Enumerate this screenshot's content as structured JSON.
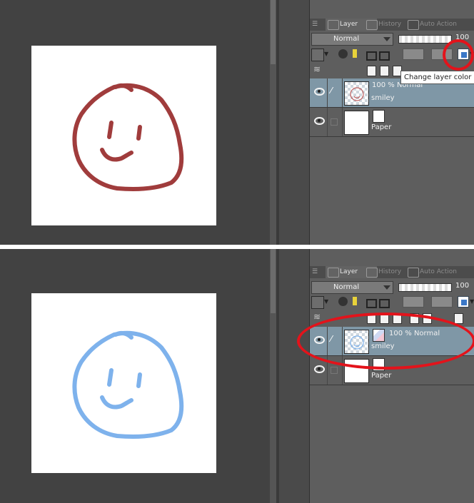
{
  "panels": [
    {
      "tabs": [
        {
          "label": "Layer",
          "active": true,
          "icon": "layer-icon"
        },
        {
          "label": "History",
          "active": false,
          "icon": "history-icon"
        },
        {
          "label": "Auto Action",
          "active": false,
          "icon": "auto-action-icon"
        }
      ],
      "blend_mode": "Normal",
      "opacity": "100",
      "layers": [
        {
          "name": "smiley",
          "info": "100 % Normal",
          "selected": true
        },
        {
          "name": "Paper",
          "info": "",
          "selected": false
        }
      ],
      "tooltip": "Change layer color",
      "stroke_color": "#a03c3c"
    },
    {
      "tabs": [
        {
          "label": "Layer",
          "active": true,
          "icon": "layer-icon"
        },
        {
          "label": "History",
          "active": false,
          "icon": "history-icon"
        },
        {
          "label": "Auto Action",
          "active": false,
          "icon": "auto-action-icon"
        }
      ],
      "blend_mode": "Normal",
      "opacity": "100",
      "layers": [
        {
          "name": "smiley",
          "info": "100 % Normal",
          "selected": true
        },
        {
          "name": "Paper",
          "info": "",
          "selected": false
        }
      ],
      "stroke_color": "#7eb2ec"
    }
  ],
  "annotation_color": "#e3131b"
}
